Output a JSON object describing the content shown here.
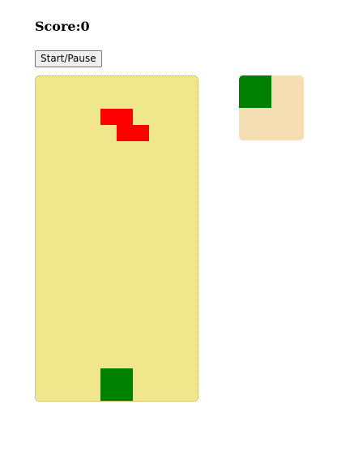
{
  "score": {
    "label": "Score:0"
  },
  "controls": {
    "start_pause_label": "Start/Pause"
  },
  "colors": {
    "board_background": "#f0e68c",
    "preview_background": "#f5deb3",
    "active_piece": "#ff0000",
    "landed_piece": "#008000",
    "next_piece": "#008000"
  },
  "board": {
    "columns": 10,
    "rows": 20,
    "active_piece": {
      "shape": "Z",
      "color": "#ff0000",
      "cells": [
        [
          4,
          2
        ],
        [
          5,
          2
        ],
        [
          5,
          3
        ],
        [
          6,
          3
        ]
      ]
    },
    "landed_blocks": [
      {
        "shape": "O",
        "color": "#008000",
        "cells": [
          [
            4,
            18
          ],
          [
            5,
            18
          ],
          [
            4,
            19
          ],
          [
            5,
            19
          ]
        ]
      }
    ]
  },
  "next_piece": {
    "shape": "O",
    "color": "#008000",
    "cells": [
      [
        0,
        0
      ],
      [
        1,
        0
      ],
      [
        0,
        1
      ],
      [
        1,
        1
      ]
    ]
  }
}
